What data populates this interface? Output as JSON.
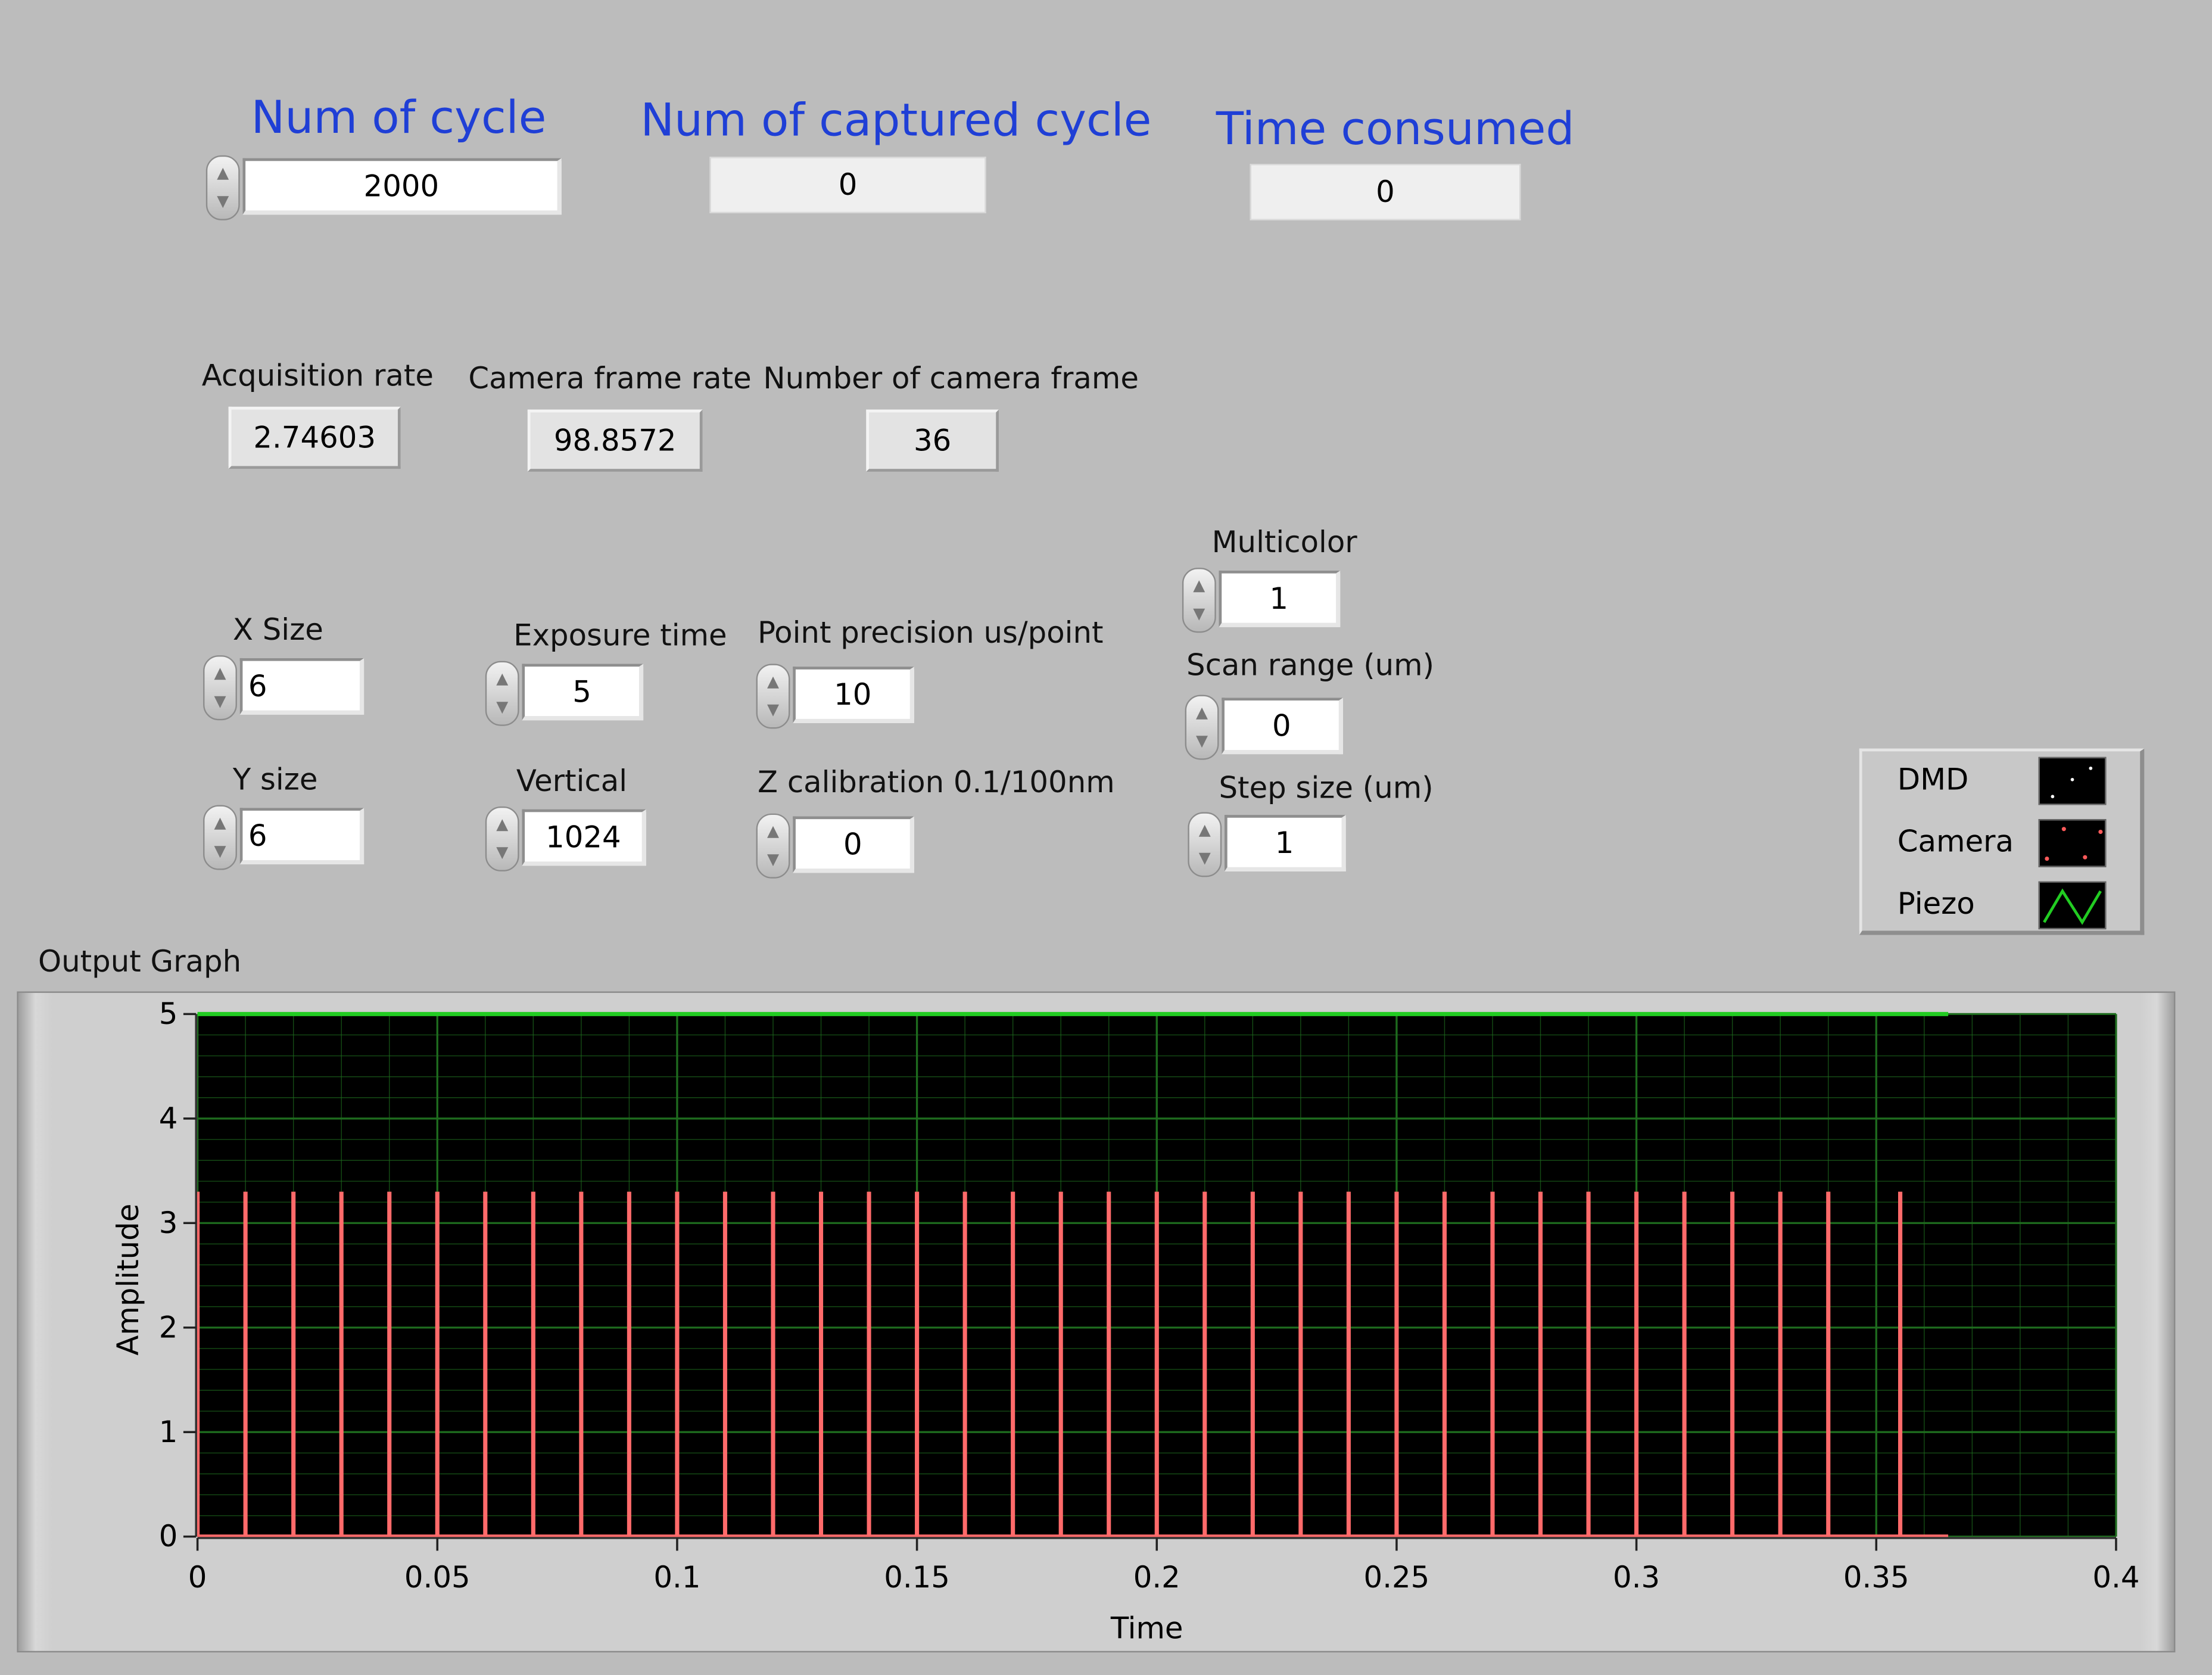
{
  "header": {
    "num_of_cycle": {
      "label": "Num of cycle",
      "value": "2000"
    },
    "num_captured": {
      "label": "Num of captured cycle",
      "value": "0"
    },
    "time_consumed": {
      "label": "Time consumed",
      "value": "0"
    }
  },
  "rates": {
    "acquisition_rate": {
      "label": "Acquisition rate",
      "value": "2.74603"
    },
    "camera_frame_rate": {
      "label": "Camera frame rate",
      "value": "98.8572"
    },
    "number_camera_frame": {
      "label": "Number of camera frame",
      "value": "36"
    }
  },
  "controls": {
    "x_size": {
      "label": "X Size",
      "value": "6"
    },
    "y_size": {
      "label": "Y size",
      "value": "6"
    },
    "exposure_time": {
      "label": "Exposure time",
      "value": "5"
    },
    "vertical": {
      "label": "Vertical",
      "value": "1024"
    },
    "point_precision": {
      "label": "Point precision us/point",
      "value": "10"
    },
    "z_calibration": {
      "label": "Z calibration 0.1/100nm",
      "value": "0"
    },
    "multicolor": {
      "label": "Multicolor",
      "value": "1"
    },
    "scan_range": {
      "label": "Scan range (um)",
      "value": "0"
    },
    "step_size": {
      "label": "Step size (um)",
      "value": "1"
    }
  },
  "legend": {
    "items": [
      {
        "name": "DMD",
        "color": "#ffffff"
      },
      {
        "name": "Camera",
        "color": "#ff5a5a"
      },
      {
        "name": "Piezo",
        "color": "#22cc22"
      }
    ]
  },
  "graph": {
    "title": "Output Graph"
  },
  "chart_data": {
    "type": "line",
    "xlabel": "Time",
    "ylabel": "Amplitude",
    "xlim": [
      0,
      0.4
    ],
    "ylim": [
      0,
      5
    ],
    "x_ticks": [
      "0",
      "0.05",
      "0.1",
      "0.15",
      "0.2",
      "0.25",
      "0.3",
      "0.35",
      "0.4"
    ],
    "y_ticks": [
      "0",
      "1",
      "2",
      "3",
      "4",
      "5"
    ],
    "grid": true,
    "background": "#000000",
    "grid_color": "#1e6b1e",
    "series": [
      {
        "name": "Piezo",
        "color": "#22cc22",
        "constant": 5,
        "x_end": 0.365
      },
      {
        "name": "Camera",
        "color": "#ff6a6a",
        "pulse_height": 3.3,
        "pulse_x": [
          0.0,
          0.01,
          0.02,
          0.03,
          0.04,
          0.05,
          0.06,
          0.07,
          0.08,
          0.09,
          0.1,
          0.11,
          0.12,
          0.13,
          0.14,
          0.15,
          0.16,
          0.17,
          0.18,
          0.19,
          0.2,
          0.21,
          0.22,
          0.23,
          0.24,
          0.25,
          0.26,
          0.27,
          0.28,
          0.29,
          0.3,
          0.31,
          0.32,
          0.33,
          0.34,
          0.355
        ],
        "x_end": 0.365
      }
    ]
  }
}
